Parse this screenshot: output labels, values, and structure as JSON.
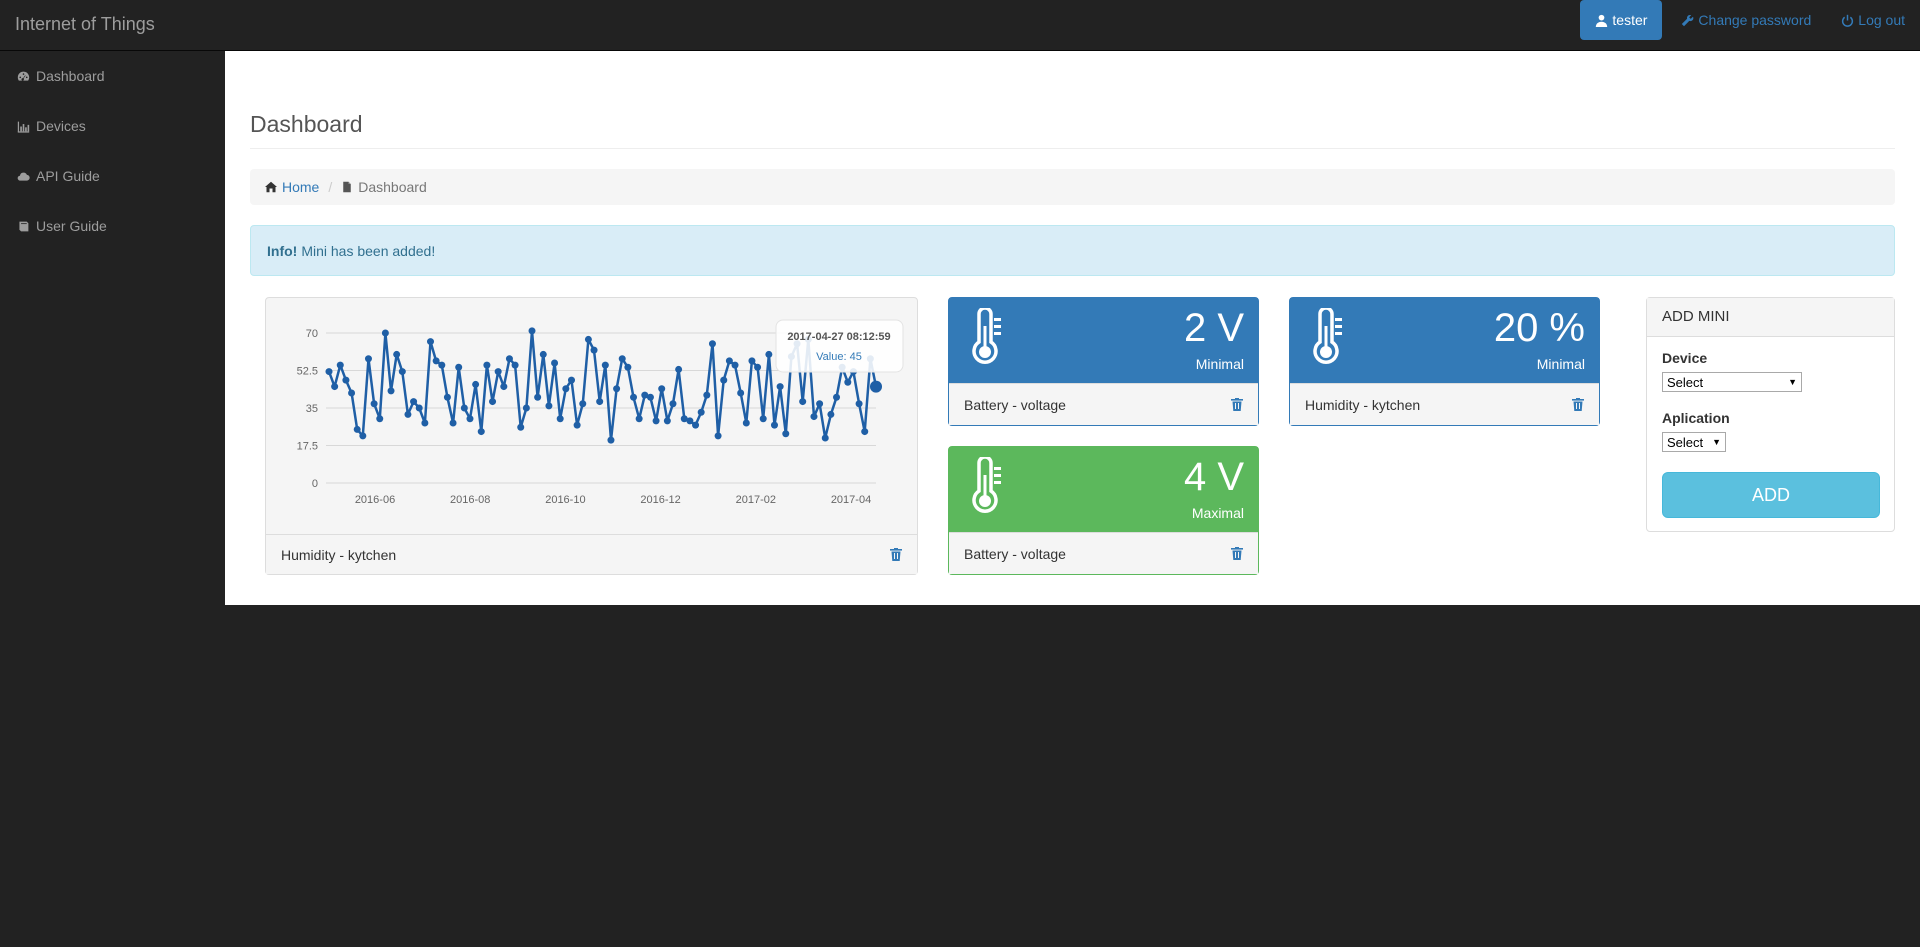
{
  "app": {
    "title": "Internet of Things"
  },
  "nav": {
    "user": "tester",
    "change_password": "Change password",
    "logout": "Log out"
  },
  "sidebar": {
    "items": [
      {
        "label": "Dashboard",
        "icon": "dashboard-icon"
      },
      {
        "label": "Devices",
        "icon": "bar-chart-icon"
      },
      {
        "label": "API Guide",
        "icon": "cloud-icon"
      },
      {
        "label": "User Guide",
        "icon": "book-icon"
      }
    ]
  },
  "page": {
    "title": "Dashboard"
  },
  "breadcrumb": {
    "home": "Home",
    "current": "Dashboard"
  },
  "alert": {
    "strong": "Info!",
    "message": "Mini has been added!"
  },
  "widgets": {
    "chart": {
      "footer": "Humidity - kytchen",
      "tooltip_date": "2017-04-27 08:12:59",
      "tooltip_value": "Value: 45"
    },
    "stat1": {
      "value": "2 V",
      "label": "Minimal",
      "footer": "Battery - voltage",
      "color": "#337ab7"
    },
    "stat2": {
      "value": "20 %",
      "label": "Minimal",
      "footer": "Humidity - kytchen",
      "color": "#337ab7"
    },
    "stat3": {
      "value": "4 V",
      "label": "Maximal",
      "footer": "Battery - voltage",
      "color": "#5cb85c"
    }
  },
  "add_mini": {
    "title": "ADD MINI",
    "device_label": "Device",
    "device_value": "Select",
    "application_label": "Aplication",
    "application_value": "Select",
    "button": "ADD"
  },
  "chart_data": {
    "type": "line",
    "x_tick_labels": [
      "2016-06",
      "2016-08",
      "2016-10",
      "2016-12",
      "2017-02",
      "2017-04"
    ],
    "y_tick_labels": [
      "70",
      "52.5",
      "35",
      "17.5",
      "0"
    ],
    "ylim": [
      0,
      70
    ],
    "series": [
      {
        "values": [
          52,
          45,
          55,
          48,
          42,
          25,
          22,
          58,
          37,
          30,
          70,
          43,
          60,
          52,
          32,
          38,
          35,
          28,
          66,
          57,
          55,
          40,
          28,
          54,
          35,
          30,
          46,
          24,
          55,
          38,
          52,
          45,
          58,
          55,
          26,
          35,
          71,
          40,
          60,
          36,
          56,
          30,
          44,
          48,
          27,
          37,
          67,
          62,
          38,
          55,
          20,
          44,
          58,
          54,
          40,
          30,
          41,
          40,
          29,
          44,
          29,
          37,
          53,
          30,
          29,
          27,
          33,
          41,
          65,
          22,
          48,
          57,
          55,
          42,
          28,
          57,
          54,
          30,
          60,
          27,
          45,
          23,
          59,
          65,
          38,
          67,
          31,
          37,
          21,
          32,
          40,
          54,
          47,
          52,
          37,
          24,
          58,
          45
        ]
      }
    ]
  }
}
